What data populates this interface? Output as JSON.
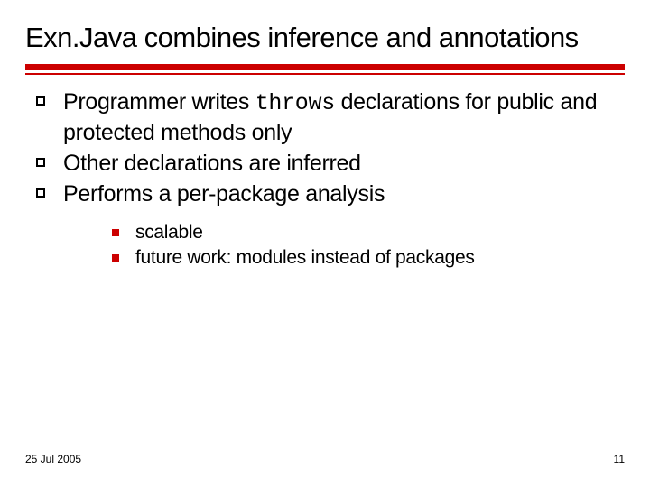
{
  "title": "Exn.Java combines inference and annotations",
  "bullets": [
    {
      "pre": "Programmer writes ",
      "code": "throws",
      "post": " declarations for public and protected methods only"
    },
    {
      "pre": "Other declarations are inferred",
      "code": "",
      "post": ""
    },
    {
      "pre": "Performs a per-package analysis",
      "code": "",
      "post": ""
    }
  ],
  "subbullets": [
    "scalable",
    "future work: modules instead of packages"
  ],
  "footer": {
    "date": "25 Jul 2005",
    "page": "11"
  }
}
